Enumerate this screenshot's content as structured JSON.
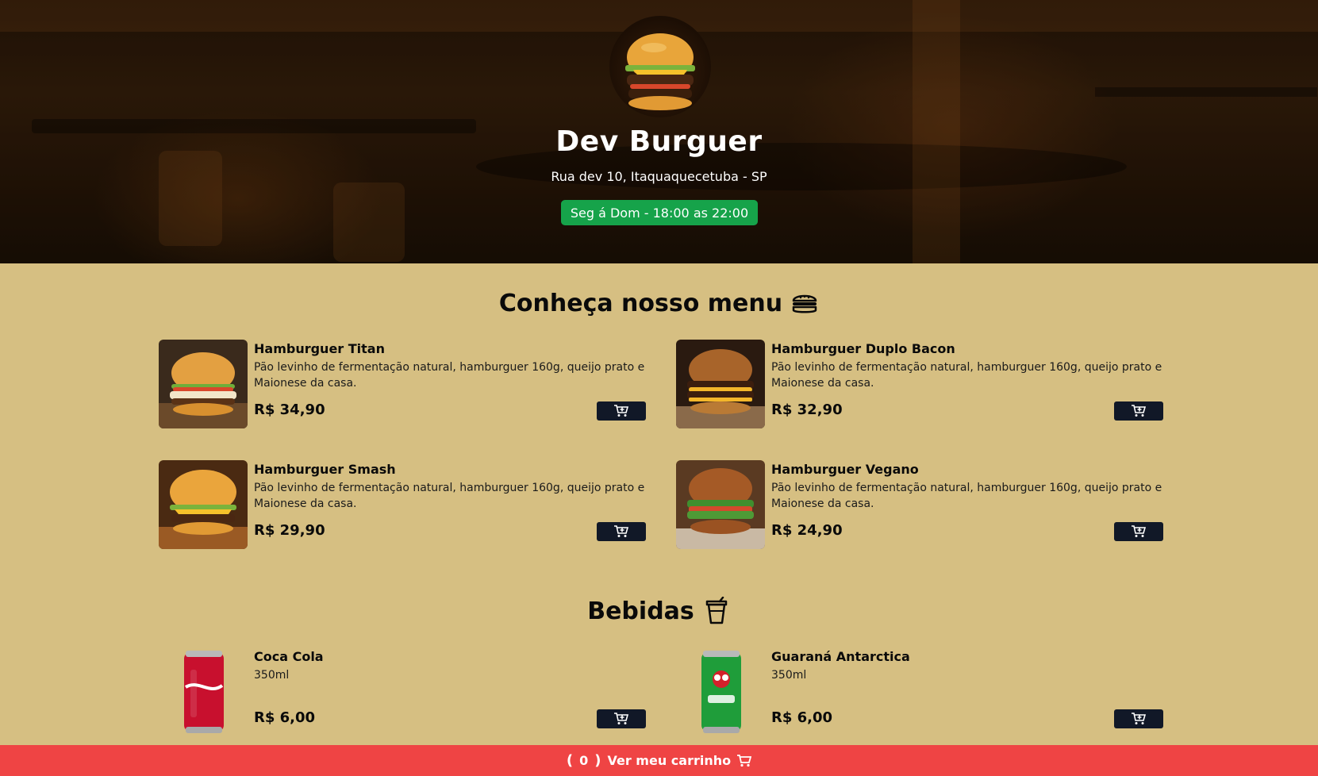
{
  "header": {
    "brand_name": "Dev Burguer",
    "address": "Rua dev 10, Itaquaquecetuba - SP",
    "hours": "Seg á Dom - 18:00 as 22:00",
    "logo_icon": "burger-logo",
    "hours_badge_color": "#16a34a"
  },
  "menu": {
    "title": "Conheça nosso menu",
    "icon": "burger-icon",
    "items": [
      {
        "name": "Hamburguer Titan",
        "description": "Pão levinho de fermentação natural, hamburguer 160g, queijo prato e Maionese da casa.",
        "price": "R$ 34,90"
      },
      {
        "name": "Hamburguer Duplo Bacon",
        "description": "Pão levinho de fermentação natural, hamburguer 160g, queijo prato e Maionese da casa.",
        "price": "R$ 32,90"
      },
      {
        "name": "Hamburguer Smash",
        "description": "Pão levinho de fermentação natural, hamburguer 160g, queijo prato e Maionese da casa.",
        "price": "R$ 29,90"
      },
      {
        "name": "Hamburguer Vegano",
        "description": "Pão levinho de fermentação natural, hamburguer 160g, queijo prato e Maionese da casa.",
        "price": "R$ 24,90"
      }
    ]
  },
  "drinks": {
    "title": "Bebidas",
    "icon": "cup-icon",
    "items": [
      {
        "name": "Coca Cola",
        "description": "350ml",
        "price": "R$ 6,00",
        "can_color": "#c8102e"
      },
      {
        "name": "Guaraná Antarctica",
        "description": "350ml",
        "price": "R$ 6,00",
        "can_color": "#1f9d3a"
      }
    ]
  },
  "cart": {
    "count": "0",
    "label": "Ver meu carrinho",
    "icon": "cart-icon",
    "bar_color": "#ef4444"
  },
  "colors": {
    "page_background": "#d6bf82",
    "button_dark": "#111827"
  }
}
